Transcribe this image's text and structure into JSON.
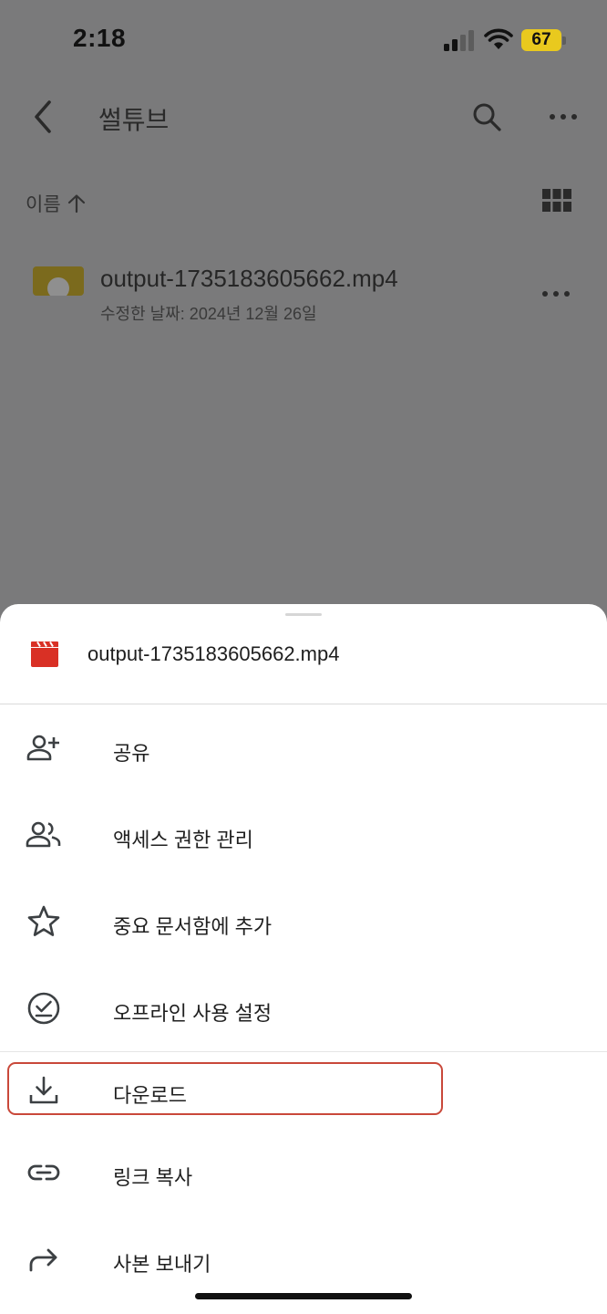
{
  "status_bar": {
    "time": "2:18",
    "battery": "67"
  },
  "top_bar": {
    "title": "썰튜브"
  },
  "sort": {
    "label": "이름"
  },
  "file": {
    "name": "output-1735183605662.mp4",
    "meta": "수정한 날짜: 2024년 12월 26일"
  },
  "sheet": {
    "title": "output-1735183605662.mp4",
    "items": [
      {
        "label": "공유",
        "icon": "person-add-icon"
      },
      {
        "label": "액세스 권한 관리",
        "icon": "people-icon"
      },
      {
        "label": "중요 문서함에 추가",
        "icon": "star-icon"
      },
      {
        "label": "오프라인 사용 설정",
        "icon": "offline-check-icon"
      },
      {
        "label": "다운로드",
        "icon": "download-icon"
      },
      {
        "label": "링크 복사",
        "icon": "link-icon"
      },
      {
        "label": "사본 보내기",
        "icon": "forward-icon"
      }
    ]
  },
  "colors": {
    "overlay": "#7a7a7b",
    "highlight": "#c9483a",
    "video_icon": "#d93025",
    "battery": "#e9c91e"
  }
}
